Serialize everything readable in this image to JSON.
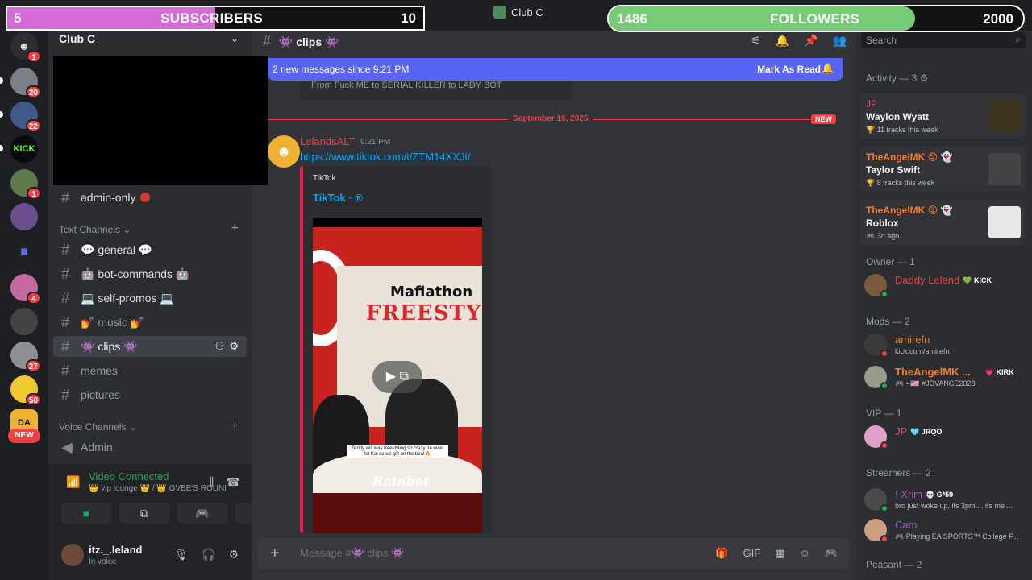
{
  "overlays": {
    "subscribers": {
      "current": "5",
      "goal": "10",
      "label": "SUBSCRIBERS",
      "progress": 0.5
    },
    "followers": {
      "current": "1486",
      "goal": "2000",
      "label": "FOLLOWERS",
      "progress": 0.74
    }
  },
  "window": {
    "title": "Club C",
    "help": "?"
  },
  "colors": {
    "sub_fill": "#d36ad6",
    "follow_fill": "#76cc74",
    "accent": "#5865f2",
    "danger": "#f23f43",
    "link": "#00a8fc",
    "online": "#23a55a"
  },
  "rail": {
    "home_badge": "1",
    "servers": [
      {
        "badge": "20"
      },
      {
        "badge": "22"
      },
      {
        "label": "KICK"
      },
      {
        "badge": "1"
      },
      {
        "badge": ""
      },
      {
        "badge": ""
      },
      {
        "badge": "4"
      },
      {
        "badge": ""
      },
      {
        "badge": "27"
      },
      {
        "badge": "50"
      },
      {
        "label": "DA"
      }
    ],
    "new_label": "NEW"
  },
  "sidebar": {
    "server_name": "Club C",
    "channels_top": [
      {
        "name": "admin-only"
      }
    ],
    "text_category": "Text Channels",
    "text_channels": [
      {
        "name": "💬 general 💬"
      },
      {
        "name": "🤖 bot-commands 🤖"
      },
      {
        "name": "💻 self-promos 💻"
      },
      {
        "name": "💅 music 💅"
      },
      {
        "name": "👾 clips 👾"
      },
      {
        "name": "memes"
      },
      {
        "name": "pictures"
      }
    ],
    "voice_category": "Voice Channels",
    "voice_channels": [
      {
        "name": "Admin"
      }
    ]
  },
  "voice": {
    "status": "Video Connected",
    "location": "👑 vip lounge 👑 / 👑 GVBE'S ROUND T..."
  },
  "user": {
    "name": "itz._.leland",
    "status": "In voice"
  },
  "chat": {
    "channel": "👾 clips 👾",
    "new_messages": "2 new messages since 9:21 PM",
    "mark_read": "Mark As Read",
    "prev_fragment": "From Fuck ME to SERIAL KILLER to LADY BOT",
    "date": "September 16, 2025",
    "new_tag": "NEW",
    "message": {
      "author": "LelandsALT",
      "time": "9:21 PM",
      "link": "https://www.tiktok.com/t/ZTM14XXJt/",
      "embed_provider": "TikTok",
      "embed_title": "TikTok · ®",
      "video_logo_top": "Mafiathon",
      "video_logo_bottom": "FREESTYLE",
      "video_caption": "Zeddy will was freestyling so crazy he even let Kai cenat get on the beat🔥",
      "video_brand": "Rainbet"
    },
    "composer_placeholder": "Message #👾 clips 👾"
  },
  "members": {
    "search_placeholder": "Search",
    "activity_header": "Activity — 3 ⚙",
    "activities": [
      {
        "user": "JP",
        "title": "Waylon Wyatt",
        "sub": "🏆 11 tracks this week",
        "color": "#e24a7a"
      },
      {
        "user": "TheAngelMK 😡 👻",
        "title": "Taylor Swift",
        "sub": "🏆 8 tracks this week",
        "color": "#f47b2a"
      },
      {
        "user": "TheAngelMK 😡 👻",
        "title": "Roblox",
        "sub": "🎮 3d ago",
        "color": "#f47b2a"
      }
    ],
    "groups": [
      {
        "header": "Owner — 1",
        "members": [
          {
            "name": "Daddy Leland",
            "tag": "💚 KICK",
            "sub": "",
            "color": "#f23f43",
            "status": "#23a55a"
          }
        ]
      },
      {
        "header": "Mods — 2",
        "members": [
          {
            "name": "amirefn",
            "tag": "",
            "sub": "kick.com/amirefn",
            "color": "#f47b2a",
            "status": "#f23f43"
          },
          {
            "name": "TheAngelMK ...",
            "tag": "💗 KIRK",
            "sub": "🎮 • 🇺🇸 #JDVANCE2028",
            "color": "#f47b2a",
            "status": "#23a55a"
          }
        ]
      },
      {
        "header": "VIP — 1",
        "members": [
          {
            "name": "JP",
            "tag": "🩵 JRQO",
            "sub": "",
            "color": "#e24a7a",
            "status": "#f23f43"
          }
        ]
      },
      {
        "header": "Streamers — 2",
        "members": [
          {
            "name": "! Xrim",
            "tag": "💀 G*59",
            "sub": "bro just woke up, its 3pm.... its me ...",
            "color": "#9b59b6",
            "status": "#23a55a"
          },
          {
            "name": "Cam",
            "tag": "",
            "sub": "🎮 Playing EA SPORTS™ College F...",
            "color": "#9b59b6",
            "status": "#f23f43"
          }
        ]
      },
      {
        "header": "Peasant — 2",
        "members": []
      }
    ]
  }
}
